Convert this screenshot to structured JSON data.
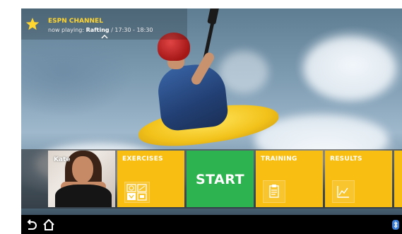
{
  "channel": {
    "name": "ESPN CHANNEL",
    "now_playing_label": "now playing:",
    "program": "Rafting",
    "time": "/ 17:30 - 18:30",
    "star_icon": "star-icon",
    "expand_icon": "chevron-up-icon"
  },
  "profile": {
    "name": "Kate"
  },
  "tiles": [
    {
      "label": "EXERCISES",
      "icon": "exercises-grid-icon"
    },
    {
      "label": "START"
    },
    {
      "label": "TRAINING",
      "icon": "clipboard-icon"
    },
    {
      "label": "RESULTS",
      "icon": "chart-line-icon"
    }
  ],
  "navbar": {
    "back_icon": "back-icon",
    "home_icon": "home-icon",
    "status_icon": "bluetooth-icon"
  },
  "colors": {
    "tile_yellow": "#f9be12",
    "tile_green": "#2db34f",
    "channel_title": "#ffd530",
    "navbar": "#000000"
  }
}
